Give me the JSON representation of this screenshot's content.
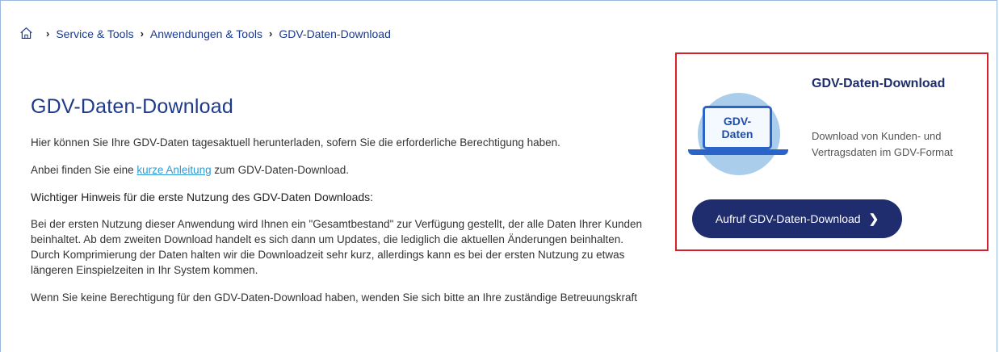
{
  "breadcrumb": {
    "home_icon": "home-icon",
    "items": [
      {
        "label": "Service & Tools"
      },
      {
        "label": "Anwendungen & Tools"
      },
      {
        "label": "GDV-Daten-Download"
      }
    ],
    "separator": "›"
  },
  "main": {
    "title": "GDV-Daten-Download",
    "intro": "Hier können Sie Ihre GDV-Daten tagesaktuell herunterladen, sofern Sie die erforderliche Berechtigung haben.",
    "guide_prefix": "Anbei finden Sie eine ",
    "guide_link": "kurze Anleitung",
    "guide_suffix": " zum GDV-Daten-Download.",
    "hint_title": "Wichtiger Hinweis für die erste Nutzung des GDV-Daten Downloads:",
    "hint_text_1": "Bei der ersten Nutzung dieser Anwendung wird Ihnen ein \"Gesamtbestand\" zur Verfügung gestellt, der alle Daten Ihrer Kunden beinhaltet. Ab dem zweiten Download handelt es sich dann um Updates, die lediglich die aktuellen Änderungen beinhalten.",
    "hint_text_2": "Durch Komprimierung der Daten halten wir die Downloadzeit sehr kurz, allerdings kann es bei der ersten Nutzung zu etwas längeren Einspielzeiten in Ihr System kommen.",
    "contact_text": "Wenn Sie keine Berechtigung für den GDV-Daten-Download haben, wenden Sie sich bitte an Ihre zuständige Betreuungskraft"
  },
  "teaser": {
    "illustration_line1": "GDV-",
    "illustration_line2": "Daten",
    "title": "GDV-Daten-Download",
    "description": "Download von Kunden- und Vertragsdaten im GDV-Format",
    "button_label": "Aufruf GDV-Daten-Download",
    "button_icon": "chevron-right-icon",
    "highlight_color": "#d6202a",
    "button_color": "#1f2c6d"
  }
}
